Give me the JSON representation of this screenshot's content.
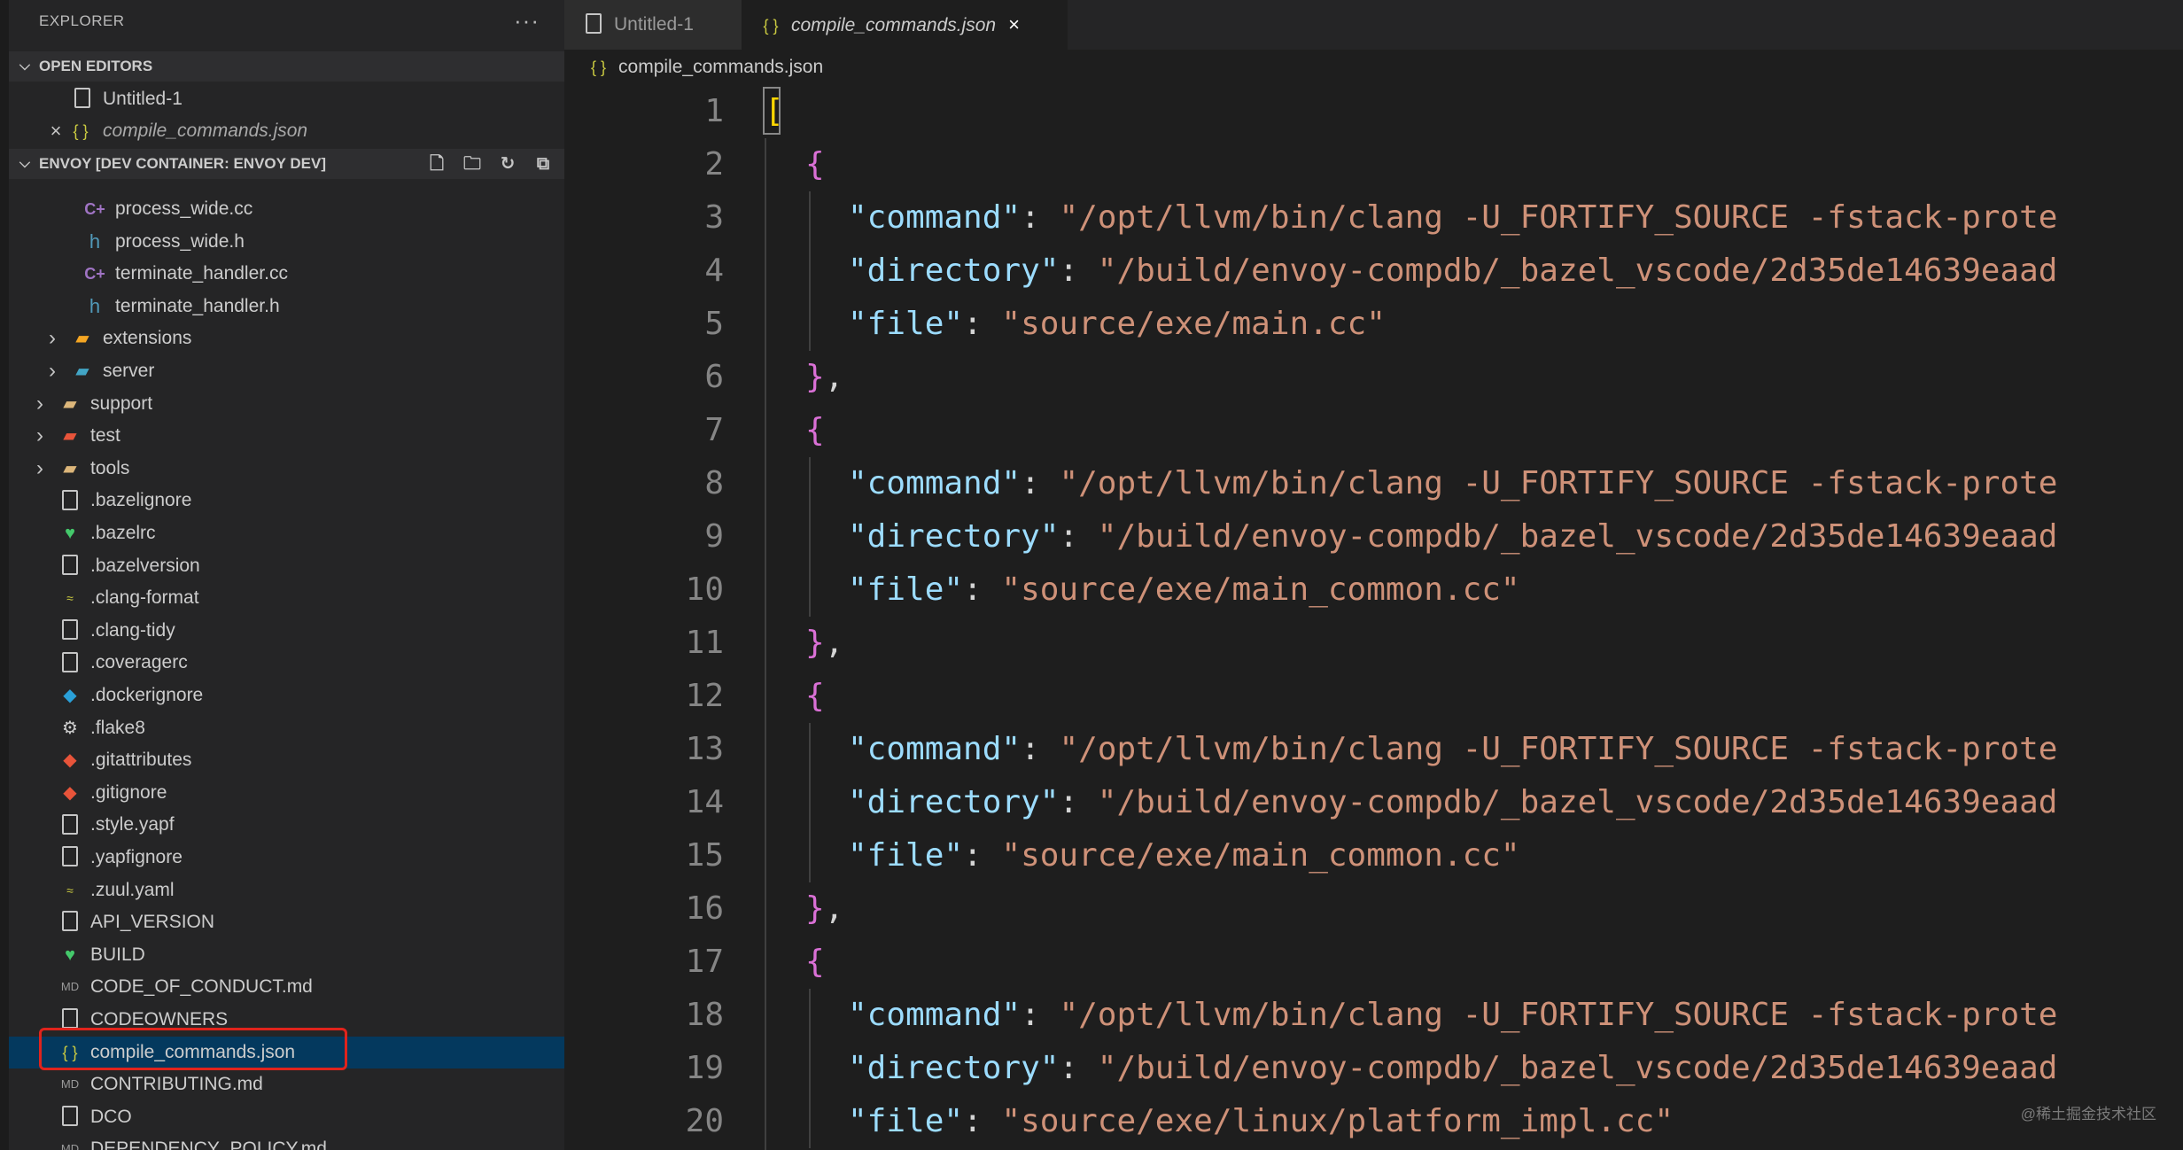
{
  "sidebar": {
    "title": "EXPLORER",
    "more": "···",
    "open_editors": {
      "header": "OPEN EDITORS",
      "items": [
        {
          "label": "Untitled-1",
          "icon": "file-icon"
        },
        {
          "label": "compile_commands.json",
          "icon": "json-icon"
        }
      ]
    },
    "workspace": {
      "header": "ENVOY [DEV CONTAINER: ENVOY DEV]",
      "items": [
        {
          "label": "process_wide.cc",
          "icon": "cpp-icon"
        },
        {
          "label": "process_wide.h",
          "icon": "header-icon"
        },
        {
          "label": "terminate_handler.cc",
          "icon": "cpp-icon"
        },
        {
          "label": "terminate_handler.h",
          "icon": "header-icon"
        },
        {
          "label": "extensions",
          "icon": "folder-icon"
        },
        {
          "label": "server",
          "icon": "folder-icon"
        },
        {
          "label": "support",
          "icon": "folder-icon"
        },
        {
          "label": "test",
          "icon": "folder-icon"
        },
        {
          "label": "tools",
          "icon": "folder-icon"
        },
        {
          "label": ".bazelignore",
          "icon": "file-icon"
        },
        {
          "label": ".bazelrc",
          "icon": "bazel-icon"
        },
        {
          "label": ".bazelversion",
          "icon": "file-icon"
        },
        {
          "label": ".clang-format",
          "icon": "config-icon"
        },
        {
          "label": ".clang-tidy",
          "icon": "file-icon"
        },
        {
          "label": ".coveragerc",
          "icon": "file-icon"
        },
        {
          "label": ".dockerignore",
          "icon": "docker-icon"
        },
        {
          "label": ".flake8",
          "icon": "gear-icon"
        },
        {
          "label": ".gitattributes",
          "icon": "git-icon"
        },
        {
          "label": ".gitignore",
          "icon": "git-icon"
        },
        {
          "label": ".style.yapf",
          "icon": "file-icon"
        },
        {
          "label": ".yapfignore",
          "icon": "file-icon"
        },
        {
          "label": ".zuul.yaml",
          "icon": "config-icon"
        },
        {
          "label": "API_VERSION",
          "icon": "file-icon"
        },
        {
          "label": "BUILD",
          "icon": "bazel-icon"
        },
        {
          "label": "CODE_OF_CONDUCT.md",
          "icon": "markdown-icon"
        },
        {
          "label": "CODEOWNERS",
          "icon": "file-icon"
        },
        {
          "label": "compile_commands.json",
          "icon": "json-icon"
        },
        {
          "label": "CONTRIBUTING.md",
          "icon": "markdown-icon"
        },
        {
          "label": "DCO",
          "icon": "file-icon"
        },
        {
          "label": "DEPENDENCY_POLICY.md",
          "icon": "markdown-icon"
        }
      ]
    }
  },
  "tabs": [
    {
      "label": "Untitled-1",
      "active": false
    },
    {
      "label": "compile_commands.json",
      "active": true,
      "close": "×"
    }
  ],
  "breadcrumb": {
    "file": "compile_commands.json"
  },
  "editor": {
    "lines": [
      {
        "n": "1",
        "parts": [
          [
            "b1",
            "["
          ]
        ]
      },
      {
        "n": "2",
        "parts": [
          [
            "b2",
            "{"
          ]
        ]
      },
      {
        "n": "3",
        "parts": [
          [
            "k",
            "\"command\""
          ],
          [
            "p",
            ": "
          ],
          [
            "s",
            "\"/opt/llvm/bin/clang -U_FORTIFY_SOURCE -fstack-prote"
          ]
        ]
      },
      {
        "n": "4",
        "parts": [
          [
            "k",
            "\"directory\""
          ],
          [
            "p",
            ": "
          ],
          [
            "s",
            "\"/build/envoy-compdb/_bazel_vscode/2d35de14639eaad"
          ]
        ]
      },
      {
        "n": "5",
        "parts": [
          [
            "k",
            "\"file\""
          ],
          [
            "p",
            ": "
          ],
          [
            "s",
            "\"source/exe/main.cc\""
          ]
        ]
      },
      {
        "n": "6",
        "parts": [
          [
            "b2",
            "}"
          ],
          [
            "p",
            ","
          ]
        ]
      },
      {
        "n": "7",
        "parts": [
          [
            "b2",
            "{"
          ]
        ]
      },
      {
        "n": "8",
        "parts": [
          [
            "k",
            "\"command\""
          ],
          [
            "p",
            ": "
          ],
          [
            "s",
            "\"/opt/llvm/bin/clang -U_FORTIFY_SOURCE -fstack-prote"
          ]
        ]
      },
      {
        "n": "9",
        "parts": [
          [
            "k",
            "\"directory\""
          ],
          [
            "p",
            ": "
          ],
          [
            "s",
            "\"/build/envoy-compdb/_bazel_vscode/2d35de14639eaad"
          ]
        ]
      },
      {
        "n": "10",
        "parts": [
          [
            "k",
            "\"file\""
          ],
          [
            "p",
            ": "
          ],
          [
            "s",
            "\"source/exe/main_common.cc\""
          ]
        ]
      },
      {
        "n": "11",
        "parts": [
          [
            "b2",
            "}"
          ],
          [
            "p",
            ","
          ]
        ]
      },
      {
        "n": "12",
        "parts": [
          [
            "b2",
            "{"
          ]
        ]
      },
      {
        "n": "13",
        "parts": [
          [
            "k",
            "\"command\""
          ],
          [
            "p",
            ": "
          ],
          [
            "s",
            "\"/opt/llvm/bin/clang -U_FORTIFY_SOURCE -fstack-prote"
          ]
        ]
      },
      {
        "n": "14",
        "parts": [
          [
            "k",
            "\"directory\""
          ],
          [
            "p",
            ": "
          ],
          [
            "s",
            "\"/build/envoy-compdb/_bazel_vscode/2d35de14639eaad"
          ]
        ]
      },
      {
        "n": "15",
        "parts": [
          [
            "k",
            "\"file\""
          ],
          [
            "p",
            ": "
          ],
          [
            "s",
            "\"source/exe/main_common.cc\""
          ]
        ]
      },
      {
        "n": "16",
        "parts": [
          [
            "b2",
            "}"
          ],
          [
            "p",
            ","
          ]
        ]
      },
      {
        "n": "17",
        "parts": [
          [
            "b2",
            "{"
          ]
        ]
      },
      {
        "n": "18",
        "parts": [
          [
            "k",
            "\"command\""
          ],
          [
            "p",
            ": "
          ],
          [
            "s",
            "\"/opt/llvm/bin/clang -U_FORTIFY_SOURCE -fstack-prote"
          ]
        ]
      },
      {
        "n": "19",
        "parts": [
          [
            "k",
            "\"directory\""
          ],
          [
            "p",
            ": "
          ],
          [
            "s",
            "\"/build/envoy-compdb/_bazel_vscode/2d35de14639eaad"
          ]
        ]
      },
      {
        "n": "20",
        "parts": [
          [
            "k",
            "\"file\""
          ],
          [
            "p",
            ": "
          ],
          [
            "s",
            "\"source/exe/linux/platform_impl.cc\""
          ]
        ]
      }
    ]
  },
  "watermark": "@稀土掘金技术社区",
  "colors": {
    "selection": "#04395e",
    "highlight": "#e0231c",
    "json_key": "#9cdcfe",
    "json_string": "#ce9178"
  }
}
